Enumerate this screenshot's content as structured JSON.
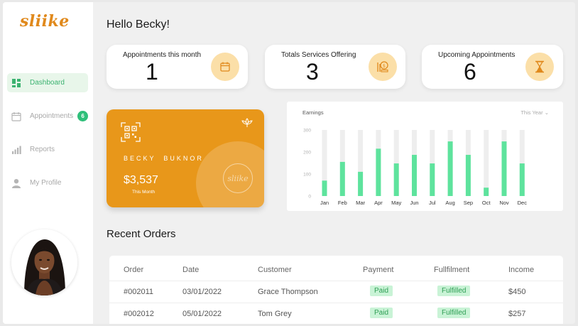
{
  "app": {
    "logo": "sliike"
  },
  "sidebar": {
    "items": [
      {
        "label": "Dashboard",
        "icon": "dashboard-icon",
        "active": true
      },
      {
        "label": "Appointments",
        "icon": "calendar-icon",
        "badge": "6"
      },
      {
        "label": "Reports",
        "icon": "bar-chart-icon"
      },
      {
        "label": "My Profile",
        "icon": "user-icon"
      }
    ],
    "avatar": "profile-photo"
  },
  "header": {
    "greeting": "Hello Becky!"
  },
  "stats": [
    {
      "label": "Appointments this month",
      "value": "1",
      "icon": "calendar-icon"
    },
    {
      "label": "Totals Services Offering",
      "value": "3",
      "icon": "services-icon"
    },
    {
      "label": "Upcoming Appointments",
      "value": "6",
      "icon": "hourglass-icon"
    }
  ],
  "card": {
    "name": "BECKY  BUKNOR",
    "amount": "$3,537",
    "sub": "This Month",
    "watermark": "sliike",
    "color": "#e8971a"
  },
  "chart": {
    "title": "Earnings",
    "filter": "This Year",
    "bar_color": "#5ee39d",
    "track_color": "#eeeeee"
  },
  "chart_data": {
    "type": "bar",
    "categories": [
      "Jan",
      "Feb",
      "Mar",
      "Apr",
      "May",
      "Jun",
      "Jul",
      "Aug",
      "Sep",
      "Oct",
      "Nov",
      "Dec"
    ],
    "values": [
      70,
      155,
      110,
      215,
      148,
      187,
      148,
      248,
      187,
      38,
      248,
      148
    ],
    "title": "Earnings",
    "xlabel": "",
    "ylabel": "",
    "yticks": [
      0,
      100,
      200,
      300
    ],
    "ylim": [
      0,
      300
    ]
  },
  "orders": {
    "title": "Recent Orders",
    "columns": [
      "Order",
      "Date",
      "Customer",
      "Payment",
      "Fullfilment",
      "Income"
    ],
    "rows": [
      {
        "order": "#002011",
        "date": "03/01/2022",
        "customer": "Grace Thompson",
        "payment": "Paid",
        "fulfilment": "Fulfilled",
        "income": "$450"
      },
      {
        "order": "#002012",
        "date": "05/01/2022",
        "customer": "Tom Grey",
        "payment": "Paid",
        "fulfilment": "Fulfilled",
        "income": "$257"
      }
    ]
  }
}
